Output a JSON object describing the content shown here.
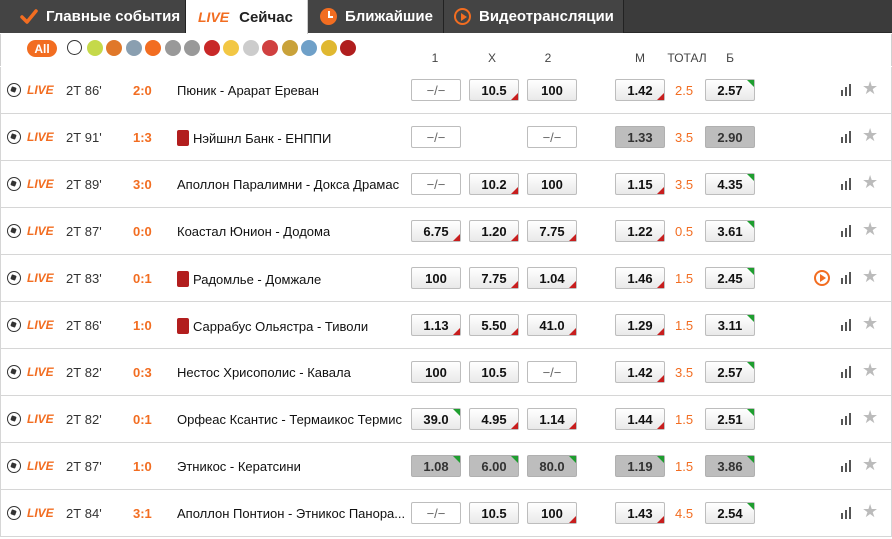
{
  "tabs": {
    "main": "Главные события",
    "live_badge": "LIVE",
    "now": "Сейчас",
    "upcoming": "Ближайшие",
    "video": "Видеотрансляции"
  },
  "filters": {
    "all": "All",
    "sports": [
      {
        "icon": "football-icon",
        "color": "#ffffff"
      },
      {
        "icon": "tennis-icon",
        "color": "#c5d94a"
      },
      {
        "icon": "basketball-icon",
        "color": "#e0782a"
      },
      {
        "icon": "hockey-icon",
        "color": "#8a9fb0"
      },
      {
        "icon": "esports-icon",
        "color": "#f26d21"
      },
      {
        "icon": "chess-icon",
        "color": "#999999"
      },
      {
        "icon": "racing-icon",
        "color": "#999999"
      },
      {
        "icon": "table-tennis-icon",
        "color": "#c82828"
      },
      {
        "icon": "volleyball-icon",
        "color": "#f2c744"
      },
      {
        "icon": "cricket-icon",
        "color": "#cccccc"
      },
      {
        "icon": "handball-icon",
        "color": "#d04040"
      },
      {
        "icon": "golf-icon",
        "color": "#c9a23a"
      },
      {
        "icon": "badminton-icon",
        "color": "#6fa0c8"
      },
      {
        "icon": "beach-volley-icon",
        "color": "#e0b830"
      },
      {
        "icon": "snooker-icon",
        "color": "#b01e1e"
      }
    ]
  },
  "columns": {
    "c1": "1",
    "cx": "X",
    "c2": "2",
    "m": "М",
    "total": "ТОТАЛ",
    "b": "Б"
  },
  "colors": {
    "accent": "#f26d21",
    "up": "#1e9e2f",
    "down": "#c81e1e"
  },
  "rows": [
    {
      "live": "LIVE",
      "time": "2Т 86'",
      "score": "2:0",
      "teams": "Пюник - Арарат Ереван",
      "card": false,
      "o1": "−/−",
      "ox": "10.5",
      "o2": "100",
      "m": "1.42",
      "total": "2.5",
      "b": "2.57",
      "video": false
    },
    {
      "live": "LIVE",
      "time": "2Т 91'",
      "score": "1:3",
      "teams": "Нэйшнл Банк - ЕНППИ",
      "card": true,
      "o1": "−/−",
      "ox": "",
      "o2": "−/−",
      "m": "1.33",
      "total": "3.5",
      "b": "2.90",
      "video": false
    },
    {
      "live": "LIVE",
      "time": "2Т 89'",
      "score": "3:0",
      "teams": "Аполлон Паралимни - Докса Драмас",
      "card": false,
      "o1": "−/−",
      "ox": "10.2",
      "o2": "100",
      "m": "1.15",
      "total": "3.5",
      "b": "4.35",
      "video": false
    },
    {
      "live": "LIVE",
      "time": "2Т 87'",
      "score": "0:0",
      "teams": "Коастал Юнион - Додома",
      "card": false,
      "o1": "6.75",
      "ox": "1.20",
      "o2": "7.75",
      "m": "1.22",
      "total": "0.5",
      "b": "3.61",
      "video": false
    },
    {
      "live": "LIVE",
      "time": "2Т 83'",
      "score": "0:1",
      "teams": "Радомлье - Домжале",
      "card": true,
      "o1": "100",
      "ox": "7.75",
      "o2": "1.04",
      "m": "1.46",
      "total": "1.5",
      "b": "2.45",
      "video": true
    },
    {
      "live": "LIVE",
      "time": "2Т 86'",
      "score": "1:0",
      "teams": "Саррабус Ольястра - Тиволи",
      "card": true,
      "o1": "1.13",
      "ox": "5.50",
      "o2": "41.0",
      "m": "1.29",
      "total": "1.5",
      "b": "3.11",
      "video": false
    },
    {
      "live": "LIVE",
      "time": "2Т 82'",
      "score": "0:3",
      "teams": "Нестос Хрисополис - Кавала",
      "card": false,
      "o1": "100",
      "ox": "10.5",
      "o2": "−/−",
      "m": "1.42",
      "total": "3.5",
      "b": "2.57",
      "video": false
    },
    {
      "live": "LIVE",
      "time": "2Т 82'",
      "score": "0:1",
      "teams": "Орфеас Ксантис - Термаикос Термис",
      "card": false,
      "o1": "39.0",
      "ox": "4.95",
      "o2": "1.14",
      "m": "1.44",
      "total": "1.5",
      "b": "2.51",
      "video": false
    },
    {
      "live": "LIVE",
      "time": "2Т 87'",
      "score": "1:0",
      "teams": "Этникос - Кератсини",
      "card": false,
      "o1": "1.08",
      "ox": "6.00",
      "o2": "80.0",
      "m": "1.19",
      "total": "1.5",
      "b": "3.86",
      "video": false
    },
    {
      "live": "LIVE",
      "time": "2Т 84'",
      "score": "3:1",
      "teams": "Аполлон Понтион - Этникос Панора...",
      "card": false,
      "o1": "−/−",
      "ox": "10.5",
      "o2": "100",
      "m": "1.43",
      "total": "4.5",
      "b": "2.54",
      "video": false
    }
  ]
}
